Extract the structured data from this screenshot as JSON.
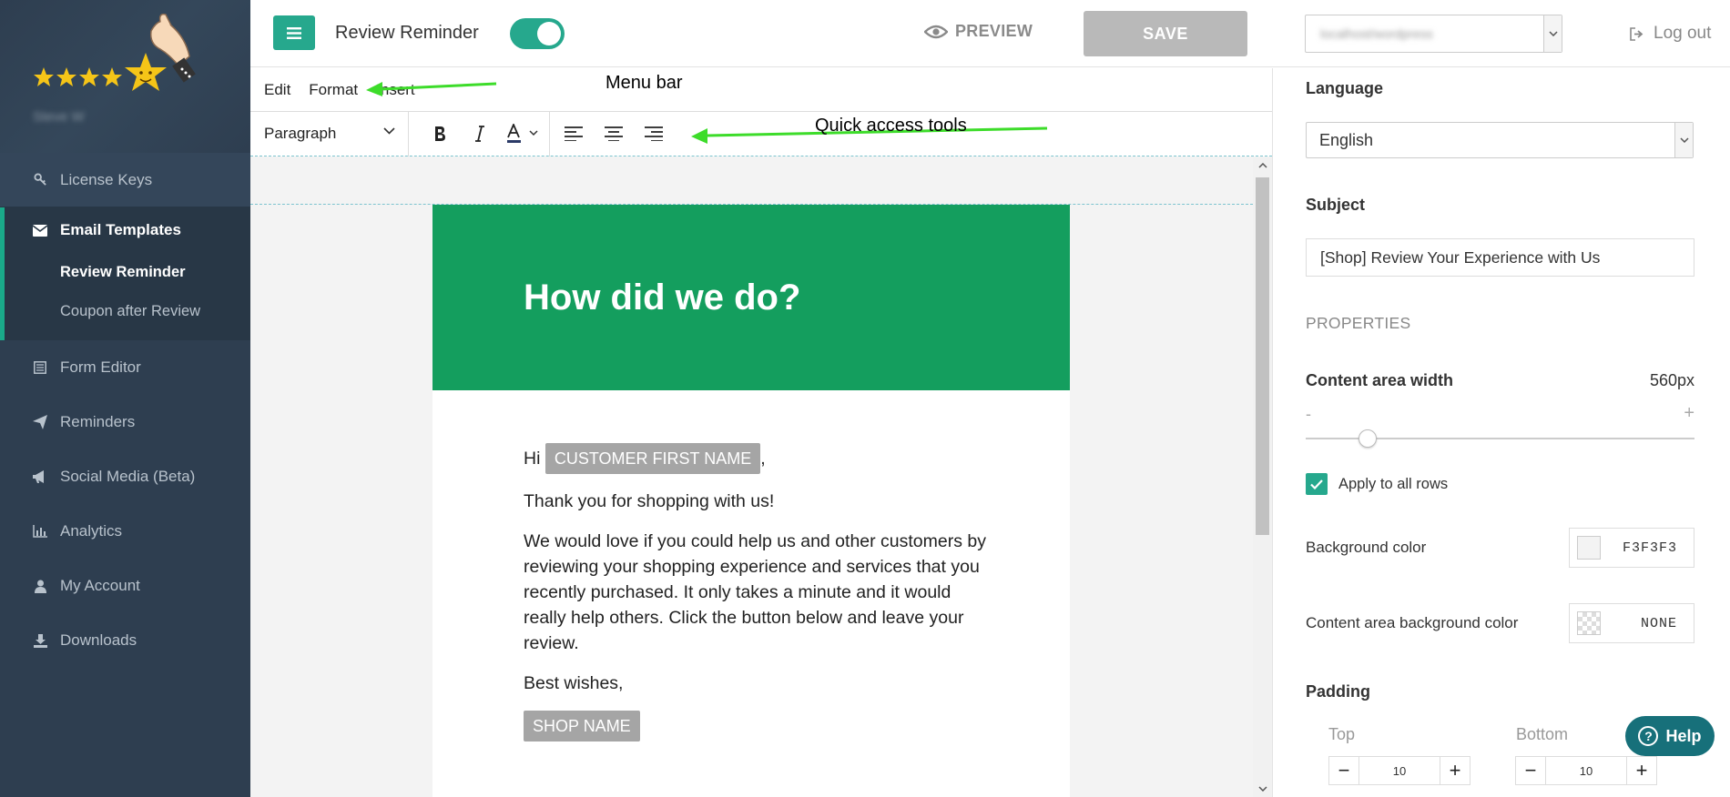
{
  "sidebar": {
    "user_name": "Steve W",
    "items_top": [
      {
        "label": "License Keys",
        "icon": "key-icon"
      }
    ],
    "group": {
      "label": "Email Templates",
      "icon": "envelope-icon",
      "subitems": [
        {
          "label": "Review Reminder",
          "active": true
        },
        {
          "label": "Coupon after Review",
          "active": false
        }
      ]
    },
    "items": [
      {
        "label": "Form Editor",
        "icon": "form-icon"
      },
      {
        "label": "Reminders",
        "icon": "paper-plane-icon"
      },
      {
        "label": "Social Media (Beta)",
        "icon": "megaphone-icon"
      },
      {
        "label": "Analytics",
        "icon": "bar-chart-icon"
      },
      {
        "label": "My Account",
        "icon": "user-icon"
      },
      {
        "label": "Downloads",
        "icon": "download-icon"
      }
    ]
  },
  "header": {
    "title": "Review Reminder",
    "toggle_on": true,
    "preview_label": "PREVIEW",
    "save_label": "SAVE",
    "shop_select_value": "localhost/wordpress",
    "logout_label": "Log out"
  },
  "editor": {
    "menu": [
      "Edit",
      "Format",
      "Insert"
    ],
    "block_format": "Paragraph",
    "annotations": {
      "menu_bar": "Menu bar",
      "quick_tools": "Quick access tools"
    }
  },
  "email": {
    "heading": "How did we do?",
    "greeting": "Hi",
    "customer_tag": "CUSTOMER FIRST NAME",
    "greeting_suffix": ",",
    "thanks": "Thank you for shopping with us!",
    "body": "We would love if you could help us and other customers by reviewing your shopping experience and services that you recently purchased. It only takes a minute and it would really help others. Click the button below and leave your review.",
    "signoff": "Best wishes,",
    "shop_tag": "SHOP NAME"
  },
  "panel": {
    "language_label": "Language",
    "language_value": "English",
    "subject_label": "Subject",
    "subject_value": "[Shop] Review Your Experience with Us",
    "properties_label": "PROPERTIES",
    "content_width_label": "Content area width",
    "content_width_value": "560px",
    "slider_fraction": 0.16,
    "slider_minus": "-",
    "slider_plus": "+",
    "apply_all_label": "Apply to all rows",
    "apply_all_checked": true,
    "bg_color_label": "Background color",
    "bg_color_value": "F3F3F3",
    "content_bg_label": "Content area background color",
    "content_bg_value": "NONE",
    "padding_label": "Padding",
    "padding_top_label": "Top",
    "padding_top_value": "10",
    "padding_bottom_label": "Bottom",
    "padding_bottom_value": "10"
  },
  "help_label": "Help",
  "colors": {
    "accent": "#26a88d",
    "sidebar": "#2e3e50",
    "email_header": "#149e5e",
    "help": "#17707a"
  }
}
